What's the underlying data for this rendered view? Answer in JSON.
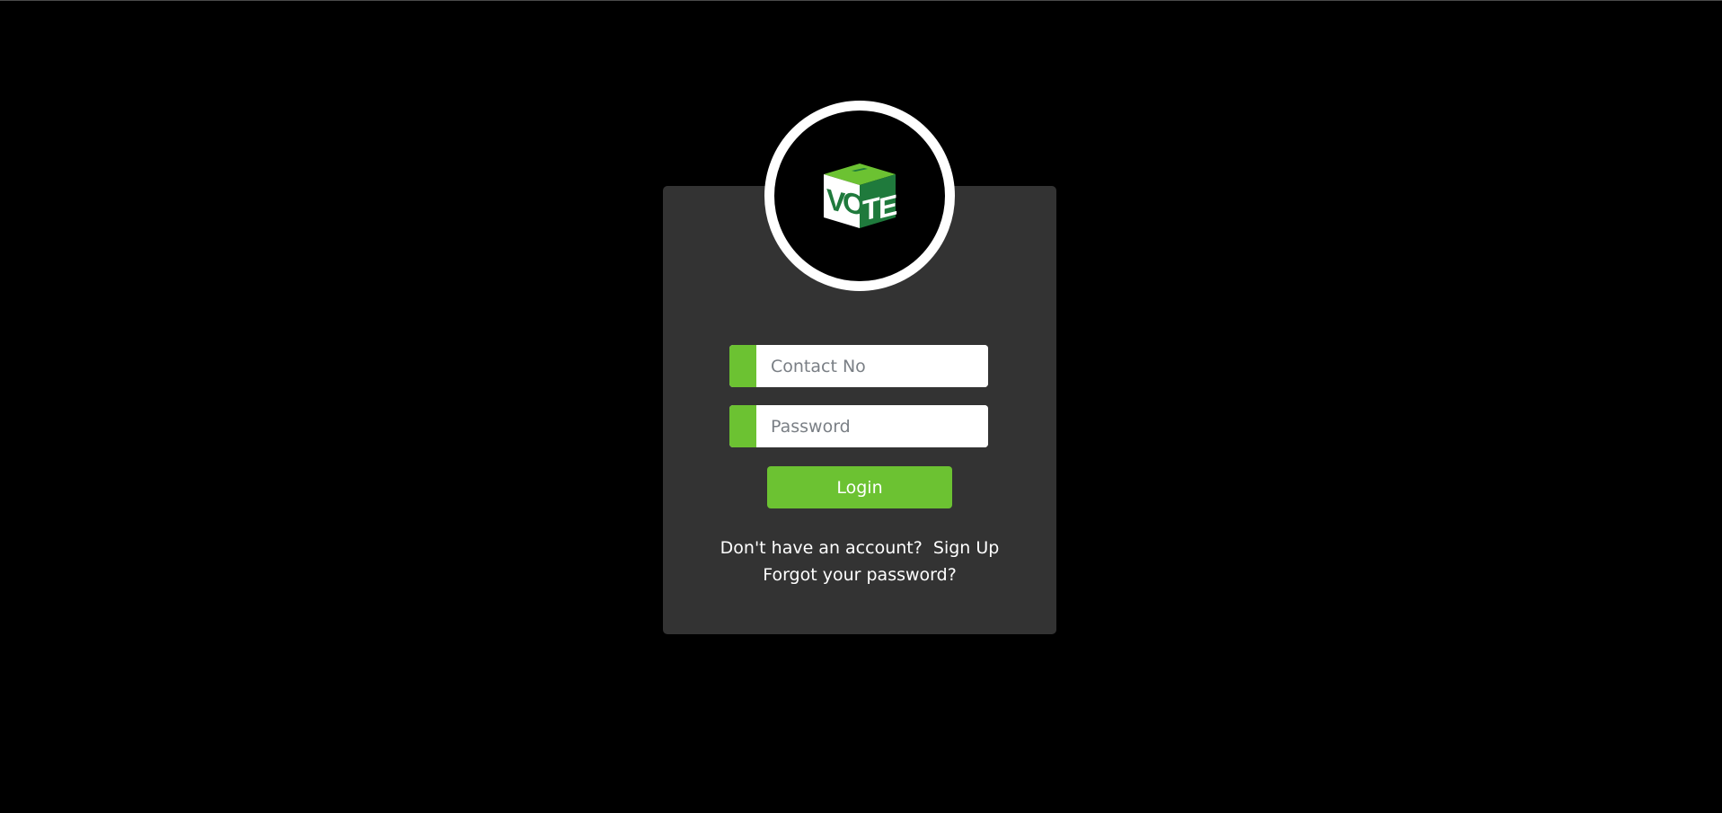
{
  "logo": {
    "icon": "vote-box-icon",
    "text": "VOTE",
    "ring_color": "#ffffff",
    "box_colors": [
      "#6cc232",
      "#1f7a3c",
      "#ffffff"
    ]
  },
  "form": {
    "contact_placeholder": "Contact No",
    "password_placeholder": "Password",
    "contact_value": "",
    "password_value": "",
    "login_label": "Login"
  },
  "links": {
    "no_account_text": "Don't have an account?",
    "signup_label": "Sign Up",
    "forgot_label": "Forgot your password?"
  },
  "colors": {
    "background": "#000000",
    "card": "#333333",
    "accent": "#6cc232"
  }
}
